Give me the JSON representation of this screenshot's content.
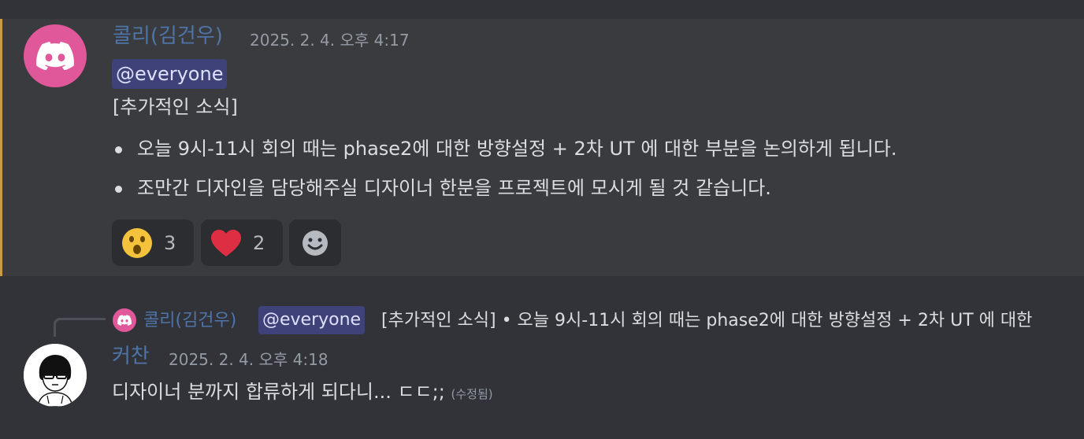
{
  "message1": {
    "author": "콜리(김건우)",
    "timestamp": "2025. 2. 4. 오후 4:17",
    "mention": "@everyone",
    "heading": "[추가적인 소식]",
    "bullets": [
      "오늘 9시-11시 회의 때는 phase2에 대한 방향설정 + 2차 UT 에 대한 부분을 논의하게 됩니다.",
      "조만간 디자인을 담당해주실 디자이너 한분을 프로젝트에 모시게 될 것 같습니다."
    ],
    "reactions": [
      {
        "icon": "surprised-face-icon",
        "count": "3"
      },
      {
        "icon": "red-heart-icon",
        "count": "2"
      }
    ],
    "add_reaction_icon": "add-reaction-smiley-icon",
    "highlight_color": "#c99a47"
  },
  "reply_preview": {
    "author": "콜리(김건우)",
    "mention": "@everyone",
    "text": "[추가적인 소식] • 오늘 9시-11시 회의 때는 phase2에 대한 방향설정 + 2차 UT 에 대한"
  },
  "message2": {
    "author": "커찬",
    "timestamp": "2025. 2. 4. 오후 4:18",
    "text": "디자이너 분까지 합류하게 되다니... ㄷㄷ;;",
    "edited": "(수정됨)"
  },
  "colors": {
    "background": "#313338",
    "highlighted_background": "#3a3b3e",
    "username": "#4e74a8",
    "mention_bg": "#3e4278",
    "avatar_pink": "#e0579a"
  }
}
